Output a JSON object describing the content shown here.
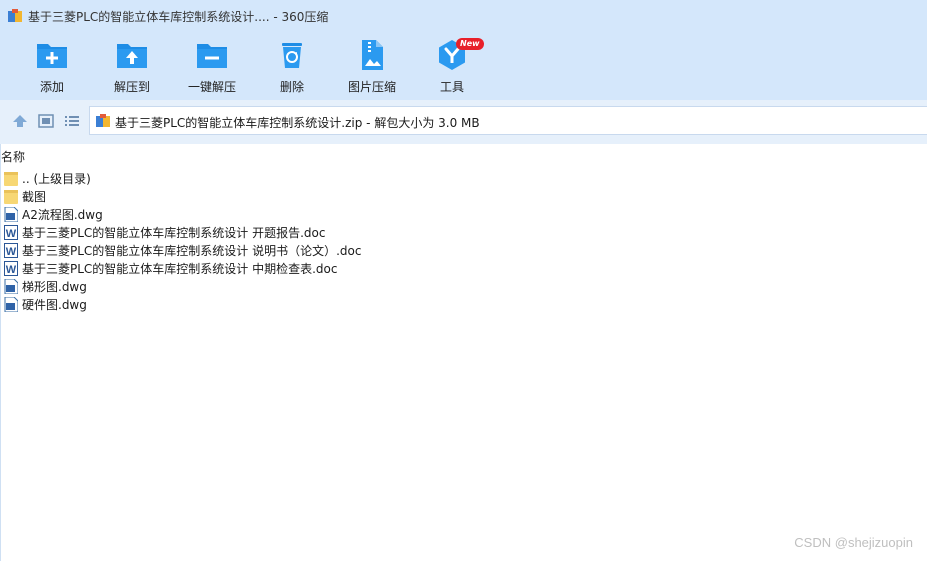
{
  "window": {
    "title": "基于三菱PLC的智能立体车库控制系统设计.... - 360压缩"
  },
  "toolbar": {
    "buttons": [
      {
        "label": "添加",
        "icon": "add-folder-icon"
      },
      {
        "label": "解压到",
        "icon": "extract-to-icon"
      },
      {
        "label": "一键解压",
        "icon": "one-click-extract-icon"
      },
      {
        "label": "删除",
        "icon": "recycle-bin-icon"
      },
      {
        "label": "图片压缩",
        "icon": "image-compress-icon"
      },
      {
        "label": "工具",
        "icon": "tools-icon",
        "badge": "New"
      }
    ]
  },
  "address": {
    "path": "基于三菱PLC的智能立体车库控制系统设计.zip - 解包大小为 3.0 MB"
  },
  "list": {
    "column_header": "名称",
    "items": [
      {
        "name": ".. (上级目录)",
        "type": "folder"
      },
      {
        "name": "截图",
        "type": "folder"
      },
      {
        "name": "A2流程图.dwg",
        "type": "dwg"
      },
      {
        "name": "基于三菱PLC的智能立体车库控制系统设计 开题报告.doc",
        "type": "doc"
      },
      {
        "name": "基于三菱PLC的智能立体车库控制系统设计 说明书（论文）.doc",
        "type": "doc"
      },
      {
        "name": "基于三菱PLC的智能立体车库控制系统设计 中期检查表.doc",
        "type": "doc"
      },
      {
        "name": "梯形图.dwg",
        "type": "dwg"
      },
      {
        "name": "硬件图.dwg",
        "type": "dwg"
      }
    ]
  },
  "watermark": "CSDN @shejizuopin",
  "colors": {
    "toolbar_bg": "#d4e7fb",
    "icon_blue": "#1e8de6",
    "badge_red": "#e8202a",
    "folder_yellow": "#f7d774",
    "doc_blue": "#2b5797"
  }
}
